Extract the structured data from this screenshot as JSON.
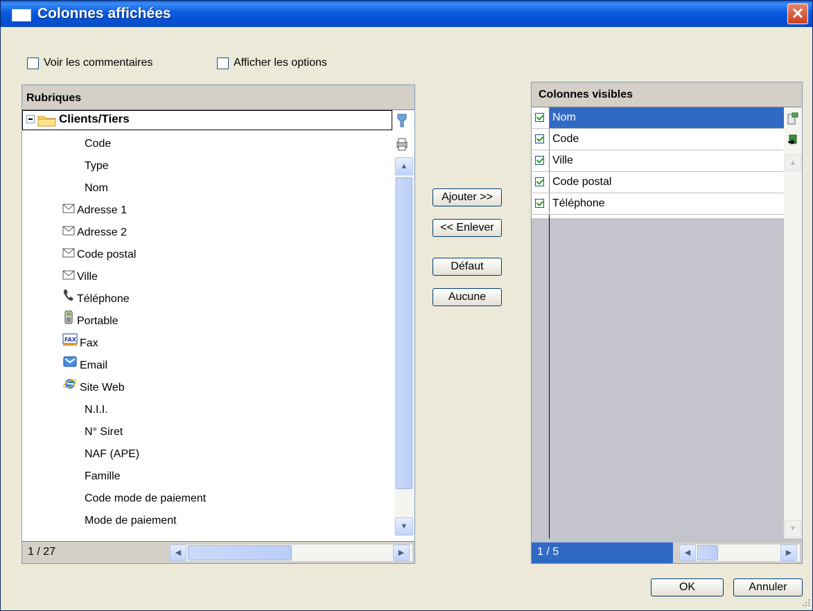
{
  "window": {
    "title": "Colonnes affichées",
    "close_glyph": "✕"
  },
  "options": {
    "voir_commentaires": "Voir les commentaires",
    "afficher_options": "Afficher les options"
  },
  "rubriques": {
    "header": "Rubriques",
    "root": {
      "label": "Clients/Tiers",
      "expander": "⊟"
    },
    "items": [
      {
        "label": "Code",
        "icon": "none"
      },
      {
        "label": "Type",
        "icon": "none"
      },
      {
        "label": "Nom",
        "icon": "none"
      },
      {
        "label": "Adresse 1",
        "icon": "envelope-icon"
      },
      {
        "label": "Adresse 2",
        "icon": "envelope-icon"
      },
      {
        "label": "Code postal",
        "icon": "envelope-icon"
      },
      {
        "label": "Ville",
        "icon": "envelope-icon"
      },
      {
        "label": "Téléphone",
        "icon": "phone-icon"
      },
      {
        "label": "Portable",
        "icon": "mobile-icon"
      },
      {
        "label": "Fax",
        "icon": "fax-icon"
      },
      {
        "label": "Email",
        "icon": "email-icon"
      },
      {
        "label": "Site Web",
        "icon": "ie-icon"
      },
      {
        "label": "N.I.I.",
        "icon": "none"
      },
      {
        "label": "N° Siret",
        "icon": "none"
      },
      {
        "label": "NAF (APE)",
        "icon": "none"
      },
      {
        "label": "Famille",
        "icon": "none"
      },
      {
        "label": "Code mode de paiement",
        "icon": "none"
      },
      {
        "label": "Mode de paiement",
        "icon": "none"
      }
    ],
    "counter": "1 / 27"
  },
  "buttons": {
    "ajouter": "Ajouter >>",
    "enlever": "<< Enlever",
    "defaut": "Défaut",
    "aucune": "Aucune",
    "ok": "OK",
    "annuler": "Annuler"
  },
  "visibles": {
    "header": "Colonnes visibles",
    "items": [
      {
        "label": "Nom",
        "checked": true,
        "selected": true
      },
      {
        "label": "Code",
        "checked": true,
        "selected": false
      },
      {
        "label": "Ville",
        "checked": true,
        "selected": false
      },
      {
        "label": "Code postal",
        "checked": true,
        "selected": false
      },
      {
        "label": "Téléphone",
        "checked": true,
        "selected": false
      }
    ],
    "counter": "1 / 5"
  },
  "colors": {
    "title_bar": "#0552d3",
    "selection": "#316ac5",
    "dialog_bg": "#ece9d8"
  }
}
